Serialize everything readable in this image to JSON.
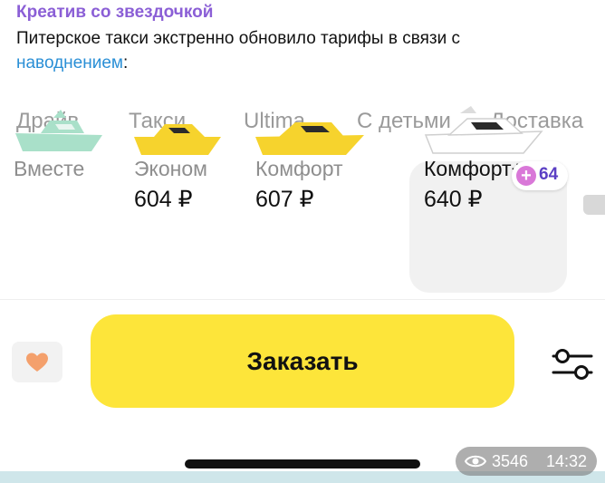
{
  "message": {
    "channel": "Креатив со звездочкой",
    "text_before_link": "Питерское такси экстренно обновило тарифы в связи с",
    "link": "наводнением",
    "text_after_link": ":"
  },
  "tabs": [
    "Драйв",
    "Такси",
    "Ultima",
    "С детьми",
    "Доставка"
  ],
  "tariffs": [
    {
      "name": "Вместе",
      "price": "",
      "boat_color": "#a9e0c9"
    },
    {
      "name": "Эконом",
      "price": "604 ₽",
      "boat_color": "#f6d32d"
    },
    {
      "name": "Комфорт",
      "price": "607 ₽",
      "boat_color": "#f6d32d"
    },
    {
      "name": "Комфорт+",
      "price": "640 ₽",
      "boat_color": "#ffffff",
      "selected": true,
      "badge": "64"
    }
  ],
  "order_button": "Заказать",
  "stats": {
    "views": "3546",
    "time": "14:32"
  },
  "colors": {
    "accent": "#fde53a",
    "channel": "#8b5fd6",
    "link": "#2a8fd6",
    "badge": "#5b3fc4"
  },
  "icons": [
    "heart-icon",
    "plus-icon",
    "filters-icon",
    "eye-icon"
  ]
}
